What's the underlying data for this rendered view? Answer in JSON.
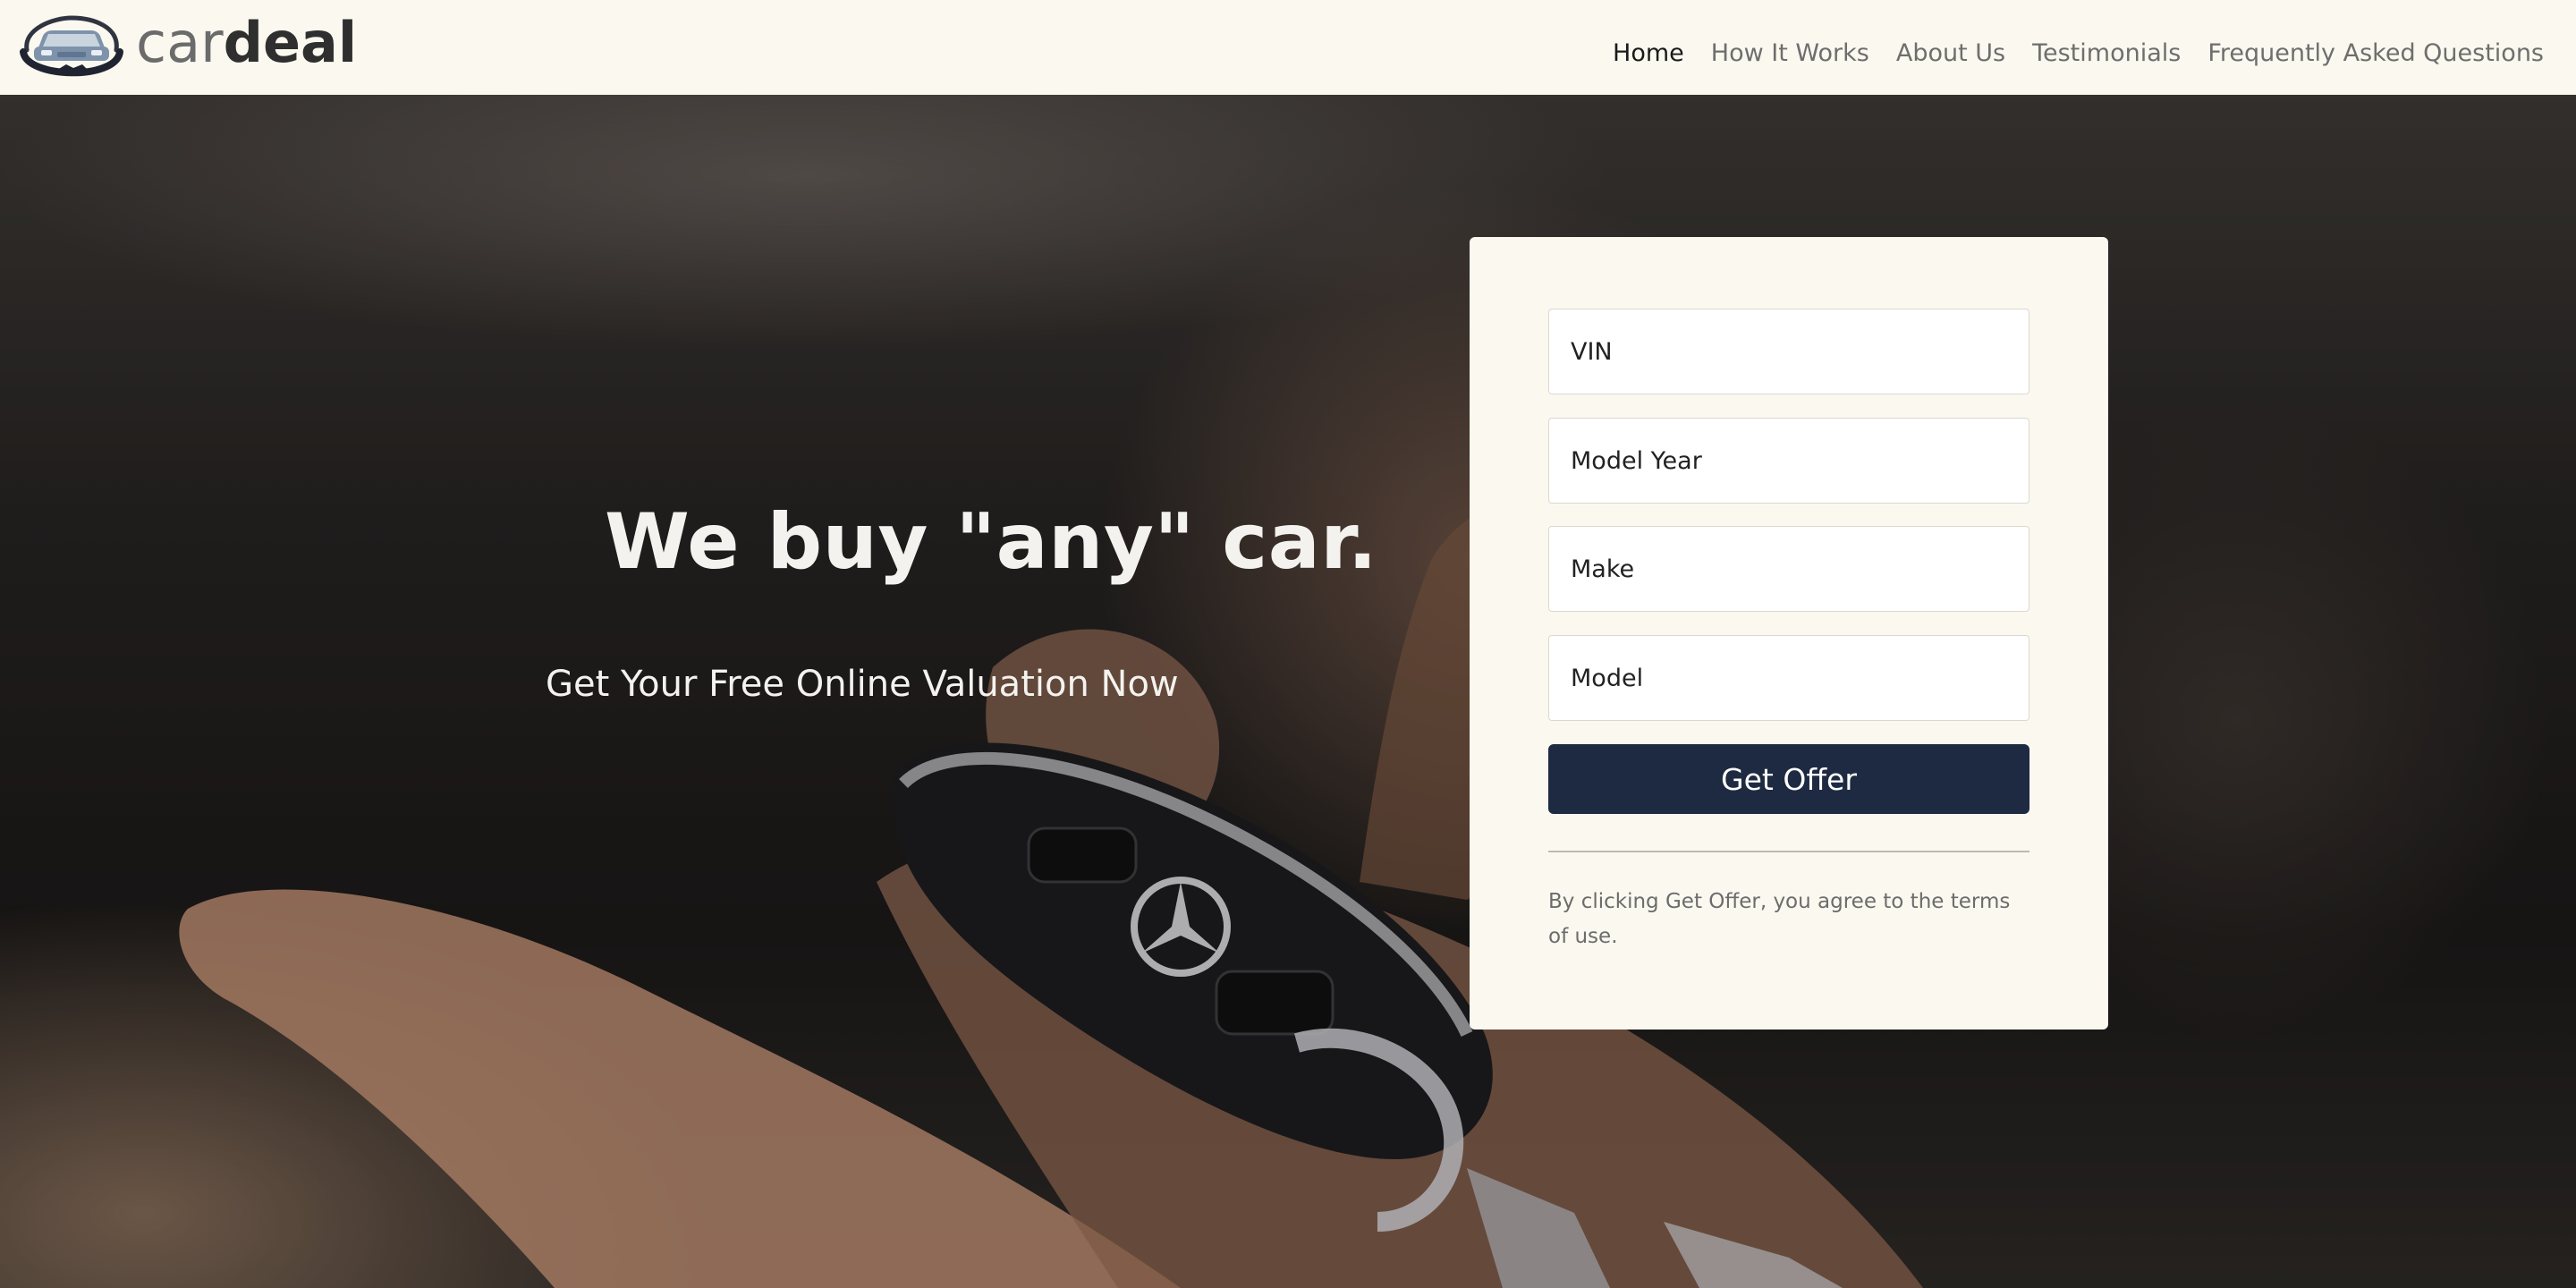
{
  "header": {
    "logo": {
      "word1": "car",
      "word2": "deal"
    },
    "nav": [
      {
        "label": "Home",
        "active": true
      },
      {
        "label": "How It Works",
        "active": false
      },
      {
        "label": "About Us",
        "active": false
      },
      {
        "label": "Testimonials",
        "active": false
      },
      {
        "label": "Frequently Asked Questions",
        "active": false
      }
    ]
  },
  "hero": {
    "title": "We buy \"any\" car.",
    "subtitle": "Get Your Free Online Valuation Now"
  },
  "form": {
    "vin_placeholder": "VIN",
    "year_placeholder": "Model Year",
    "make_placeholder": "Make",
    "model_placeholder": "Model",
    "submit_label": "Get Offer",
    "terms": "By clicking Get Offer, you agree to the terms of use."
  },
  "colors": {
    "header_bg": "#fbf8ef",
    "card_bg": "#fbf8ef",
    "button_bg": "#1e2a41",
    "button_text": "#ffffff",
    "nav_active": "#1a1a1a",
    "nav_inactive": "#6e6e6e"
  },
  "icons": {
    "logo": "car-handshake-icon"
  }
}
